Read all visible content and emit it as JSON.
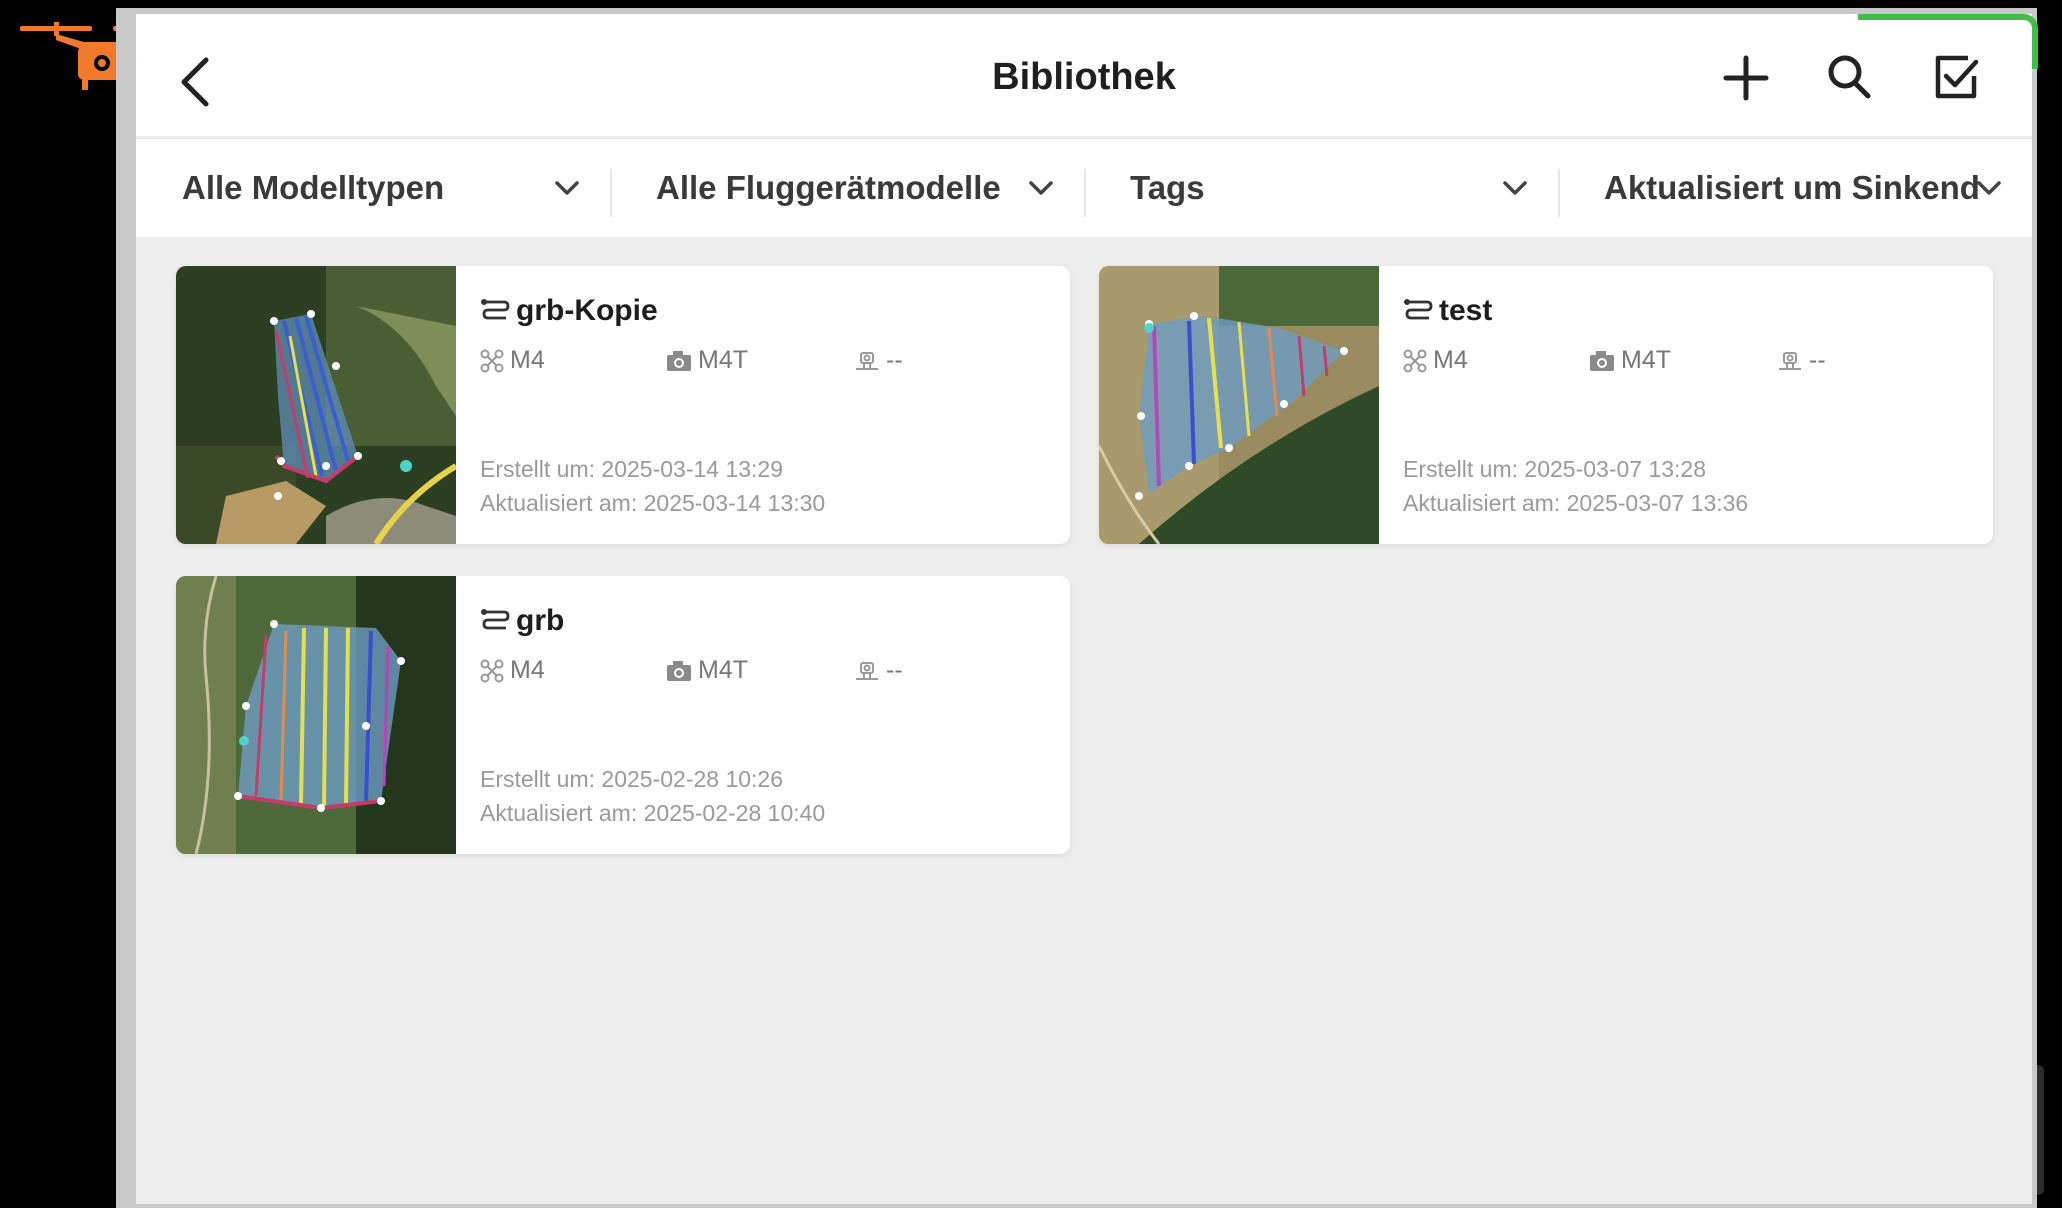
{
  "header": {
    "title": "Bibliothek"
  },
  "filters": [
    {
      "label": "Alle Modelltypen"
    },
    {
      "label": "Alle Fluggerätmodelle"
    },
    {
      "label": "Tags"
    },
    {
      "label": "Aktualisiert um Sinkend"
    }
  ],
  "missions": [
    {
      "name": "grb-Kopie",
      "aircraft": "M4",
      "camera": "M4T",
      "payload": "--",
      "created": "Erstellt um: 2025-03-14 13:29",
      "updated": "Aktualisiert am: 2025-03-14 13:30"
    },
    {
      "name": "test",
      "aircraft": "M4",
      "camera": "M4T",
      "payload": "--",
      "created": "Erstellt um: 2025-03-07 13:28",
      "updated": "Aktualisiert am: 2025-03-07 13:36"
    },
    {
      "name": "grb",
      "aircraft": "M4",
      "camera": "M4T",
      "payload": "--",
      "created": "Erstellt um: 2025-02-28 10:26",
      "updated": "Aktualisiert am: 2025-02-28 10:40"
    }
  ],
  "icons": {
    "back": "chevron-left-icon",
    "add": "plus-icon",
    "search": "search-icon",
    "select": "checkbox-icon",
    "logo": "drone-logo-icon"
  },
  "colors": {
    "accent": "#3fbf4a",
    "logo": "#f07a2a"
  }
}
